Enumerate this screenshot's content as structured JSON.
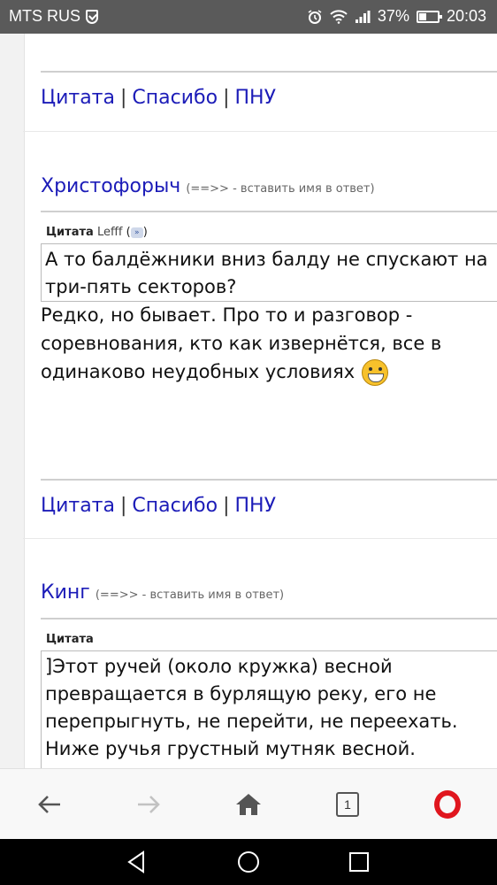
{
  "status_bar": {
    "carrier": "MTS RUS",
    "battery_percent": "37%",
    "time": "20:03"
  },
  "post1_actions": {
    "quote": "Цитата",
    "thanks": "Спасибо",
    "pnu": "ПНУ",
    "separator": "|"
  },
  "post2": {
    "author": "Христофорыч",
    "insert_hint": "(==>> - вставить имя в ответ)",
    "quote_label": "Цитата",
    "quote_author": "Lefff",
    "quote_text": "А то балдёжники вниз балду не спускают на три-пять секторов?",
    "reply_text": "Редко, но бывает. Про то и разговор - соревнования, кто как извернётся, все в одинаково неудобных условиях",
    "actions": {
      "quote": "Цитата",
      "thanks": "Спасибо",
      "pnu": "ПНУ",
      "separator": "|"
    }
  },
  "post3": {
    "author": "Кинг",
    "insert_hint": "(==>> - вставить имя в ответ)",
    "quote_label": "Цитата",
    "quote_text": "]Этот ручей (около кружка) весной превращается в бурлящую реку, его не перепрыгнуть, не перейти, не переехать. Ниже ручья грустный мутняк весной."
  },
  "browser_toolbar": {
    "tab_count": "1"
  },
  "icons": {
    "back": "back-arrow-icon",
    "forward": "forward-arrow-icon",
    "home": "home-icon",
    "tabs": "tabs-icon",
    "opera": "opera-menu-icon",
    "emoji": "grin-smiley-icon"
  },
  "colors": {
    "link": "#1c1cb8",
    "status_bar": "#5a5a5a",
    "opera_red": "#e0161e"
  }
}
